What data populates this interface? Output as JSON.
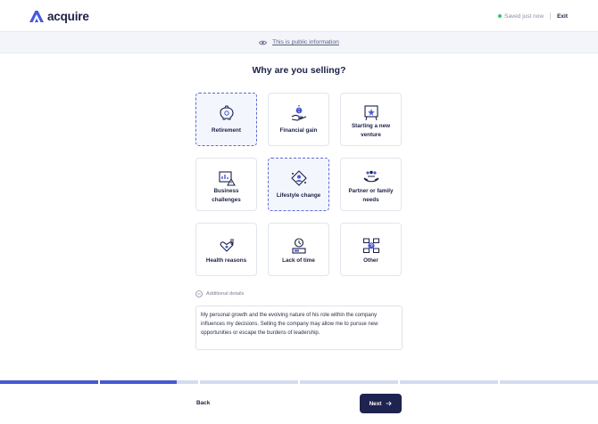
{
  "header": {
    "brand": "acquire",
    "status_text": "Saved just now",
    "exit_label": "Exit"
  },
  "info_bar": {
    "text": "This is public information"
  },
  "question": "Why are you selling?",
  "options": [
    {
      "label_lines": [
        "Retirement"
      ],
      "icon": "piggy-bank-icon",
      "selected": true
    },
    {
      "label_lines": [
        "Financial gain"
      ],
      "icon": "money-hand-icon",
      "selected": false
    },
    {
      "label_lines": [
        "Starting a new",
        "venture"
      ],
      "icon": "idea-board-icon",
      "selected": false
    },
    {
      "label_lines": [
        "Business",
        "challenges"
      ],
      "icon": "chart-warning-icon",
      "selected": false
    },
    {
      "label_lines": [
        "Lifestyle change"
      ],
      "icon": "lifestyle-cycle-icon",
      "selected": true
    },
    {
      "label_lines": [
        "Partner or family",
        "needs"
      ],
      "icon": "family-hands-icon",
      "selected": false
    },
    {
      "label_lines": [
        "Health reasons"
      ],
      "icon": "stethoscope-heart-icon",
      "selected": false
    },
    {
      "label_lines": [
        "Lack of time"
      ],
      "icon": "clock-money-icon",
      "selected": false
    },
    {
      "label_lines": [
        "Other"
      ],
      "icon": "question-grid-icon",
      "selected": false
    }
  ],
  "details": {
    "toggle_label": "Additional details",
    "text": "My personal growth and the evolving nature of his role within the company influences my decisions. Selling the company may allow me to pursue new opportunities or escape the burdens of leadership."
  },
  "progress": {
    "segments": 6,
    "completed": 1.8
  },
  "nav": {
    "back_label": "Back",
    "next_label": "Next"
  },
  "colors": {
    "brand": "#4759d3",
    "dark": "#1f2350",
    "selected_border": "#5d6bd8",
    "status_dot": "#34c46a"
  }
}
